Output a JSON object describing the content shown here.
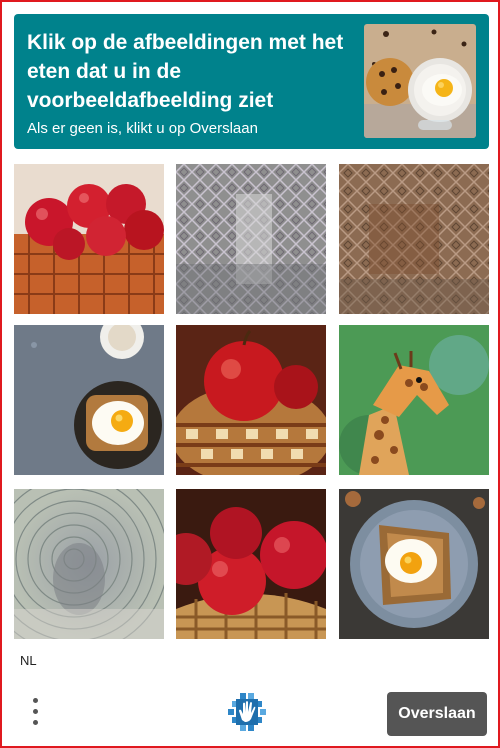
{
  "header": {
    "prompt": "Klik op de afbeeldingen met het eten dat u in de voorbeeldafbeelding ziet",
    "subprompt": "Als er geen is, klikt u op Overslaan",
    "example_image": "cookie-and-fried-egg-on-plate"
  },
  "grid": {
    "cells": [
      {
        "subject": "basket-of-red-apples"
      },
      {
        "subject": "distorted-noise-image"
      },
      {
        "subject": "distorted-noise-image"
      },
      {
        "subject": "fried-egg-on-toast-plate"
      },
      {
        "subject": "apple-in-woven-basket"
      },
      {
        "subject": "giraffe-painting"
      },
      {
        "subject": "distorted-noise-image"
      },
      {
        "subject": "apples-in-basket"
      },
      {
        "subject": "fried-egg-on-toast-plate"
      }
    ]
  },
  "footer": {
    "language": "NL",
    "skip_label": "Overslaan",
    "menu_icon": "vertical-dots-icon",
    "logo_icon": "hand-logo-icon"
  },
  "colors": {
    "header_bg": "#00828c",
    "frame_border": "#e0191f",
    "skip_bg": "#555555"
  }
}
